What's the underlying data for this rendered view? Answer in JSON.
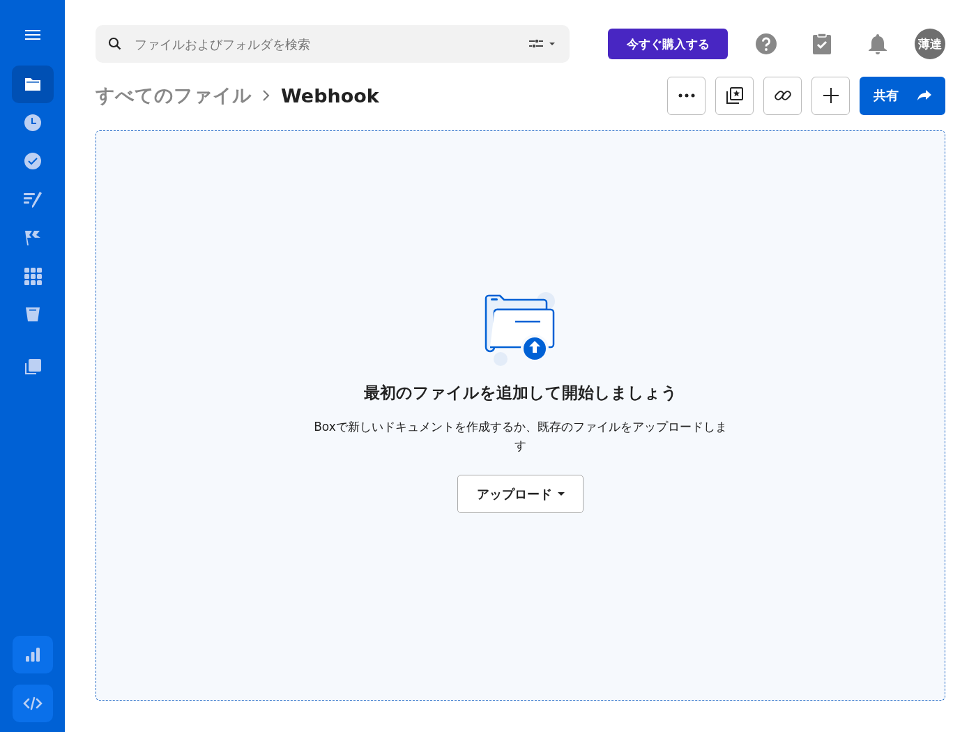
{
  "sidebar": {
    "items": [
      {
        "selected": true
      },
      {
        "selected": false
      },
      {
        "selected": false
      },
      {
        "selected": false
      },
      {
        "selected": false
      },
      {
        "selected": false
      },
      {
        "selected": false
      },
      {
        "selected": false
      }
    ]
  },
  "search": {
    "placeholder": "ファイルおよびフォルダを検索"
  },
  "header": {
    "buy_button": "今すぐ購入する",
    "avatar": "薄達"
  },
  "breadcrumb": [
    "すべてのファイル",
    "Webhook"
  ],
  "share_button": "共有",
  "empty_state": {
    "title": "最初のファイルを追加して開始しましょう",
    "description": "Boxで新しいドキュメントを作成するか、既存のファイルをアップロードします",
    "upload_button": "アップロード"
  }
}
